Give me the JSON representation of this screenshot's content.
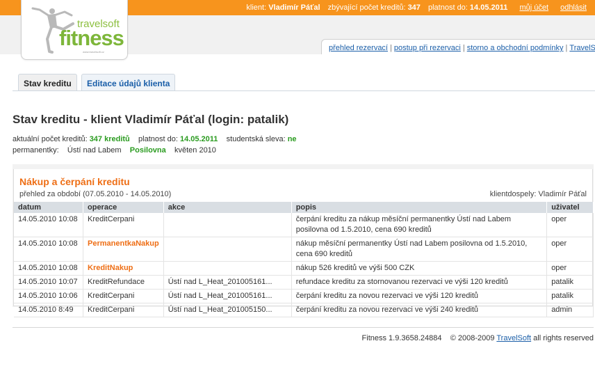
{
  "header": {
    "client_label": "klient:",
    "client_name": "Vladimír Páťal",
    "credits_label": "zbývající počet kreditů:",
    "credits_value": "347",
    "valid_label": "platnost do:",
    "valid_value": "14.05.2011",
    "my_account": "můj účet",
    "logout": "odhlásit"
  },
  "logo": {
    "brand_top": "travelsoft",
    "brand_main": "fitness",
    "tagline": "www.travelsoft.cz",
    "icon": "dancer-silhouette-icon"
  },
  "help_links": {
    "items": [
      "přehled rezervací",
      "postup při rezervaci",
      "storno a obchodní podmínky",
      "TravelSoft"
    ],
    "separator": "|"
  },
  "tabs": [
    {
      "label": "Stav kreditu",
      "active": true
    },
    {
      "label": "Editace údajů klienta",
      "active": false
    }
  ],
  "page": {
    "title": "Stav kreditu - klient Vladimír Páťal (login: patalik)"
  },
  "info": {
    "credits_label": "aktuální počet kreditů:",
    "credits_value": "347 kreditů",
    "valid_label": "platnost do:",
    "valid_value": "14.05.2011",
    "student_label": "studentská sleva:",
    "student_value": "ne",
    "passes_label": "permanentky:",
    "pass_place": "Ústí nad Labem",
    "pass_type": "Posilovna",
    "pass_month": "květen 2010"
  },
  "panel": {
    "title": "Nákup a čerpání kreditu",
    "period": "přehled za období (07.05.2010 - 14.05.2010)",
    "user_info": "klientdospely: Vladimír Páťal",
    "columns": [
      "datum",
      "operace",
      "akce",
      "popis",
      "uživatel"
    ],
    "rows": [
      {
        "datum": "14.05.2010 10:08",
        "operace": "KreditCerpani",
        "akce": "",
        "popis": "čerpání kreditu za nákup měsíční permanentky Ústí nad Labem posilovna od 1.5.2010, cena 690 kreditů",
        "uzivatel": "oper"
      },
      {
        "datum": "14.05.2010 10:08",
        "operace": "PermanentkaNakup",
        "akce": "",
        "popis": "nákup měsíční permanentky Ústí nad Labem posilovna od 1.5.2010, cena 690 kreditů",
        "uzivatel": "oper"
      },
      {
        "datum": "14.05.2010 10:08",
        "operace": "KreditNakup",
        "akce": "",
        "popis": "nákup 526 kreditů ve výši 500 CZK",
        "uzivatel": "oper"
      },
      {
        "datum": "14.05.2010 10:07",
        "operace": "KreditRefundace",
        "akce": "Ústí nad L_Heat_201005161...",
        "popis": "refundace kreditu za stornovanou rezervaci ve výši 120 kreditů",
        "uzivatel": "patalik"
      },
      {
        "datum": "14.05.2010 10:06",
        "operace": "KreditCerpani",
        "akce": "Ústí nad L_Heat_201005161...",
        "popis": "čerpání kreditu za novou rezervaci ve výši 120 kreditů",
        "uzivatel": "patalik"
      },
      {
        "datum": "14.05.2010 8:49",
        "operace": "KreditCerpani",
        "akce": "Ústí nad L_Heat_201005150...",
        "popis": "čerpání kreditu za novou rezervaci ve výši 240 kreditů",
        "uzivatel": "admin"
      }
    ]
  },
  "footer": {
    "version": "Fitness 1.9.3658.24884",
    "copyright": "© 2008-2009",
    "company": "TravelSoft",
    "rights": "all rights reserved"
  },
  "colors": {
    "top_bar": "#f7941d",
    "accent_orange": "#ee6e15",
    "link_blue": "#1a5ea8",
    "value_green": "#2a9b1f",
    "logo_green": "#7db63a",
    "table_header": "#d9dee3"
  }
}
